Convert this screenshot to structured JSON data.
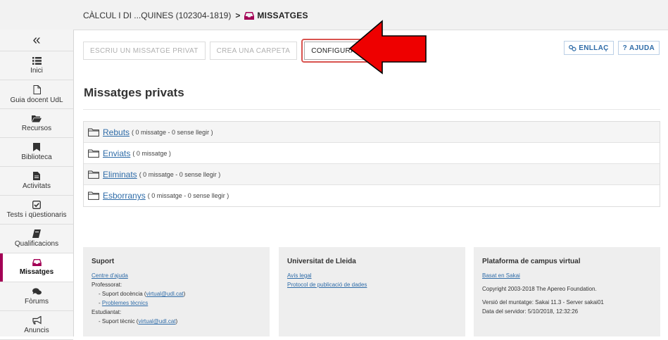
{
  "breadcrumb": {
    "site": "CÀLCUL I DI ...QUINES (102304-1819)",
    "separator": ">",
    "current": "MISSATGES"
  },
  "sidebar": {
    "collapse_glyph": "«",
    "items": [
      {
        "label": "Inici",
        "icon": "list-icon"
      },
      {
        "label": "Guia docent UdL",
        "icon": "document-icon"
      },
      {
        "label": "Recursos",
        "icon": "folder-open-icon"
      },
      {
        "label": "Biblioteca",
        "icon": "bookmark-icon"
      },
      {
        "label": "Activitats",
        "icon": "file-text-icon"
      },
      {
        "label": "Tests i qüestionaris",
        "icon": "check-square-icon"
      },
      {
        "label": "Qualificacions",
        "icon": "book-icon"
      },
      {
        "label": "Missatges",
        "icon": "inbox-icon",
        "active": true
      },
      {
        "label": "Fòrums",
        "icon": "comments-icon"
      },
      {
        "label": "Anuncis",
        "icon": "bullhorn-icon"
      }
    ]
  },
  "toolbar": {
    "private_message": "ESCRIU UN MISSATGE PRIVAT",
    "create_folder": "CREA UNA CARPETA",
    "settings": "CONFIGURACIÓ"
  },
  "right_buttons": {
    "link": "ENLLAÇ",
    "help": "AJUDA"
  },
  "page_title": "Missatges privats",
  "folders": [
    {
      "name": "Rebuts",
      "count": "( 0 missatge - 0 sense llegir )"
    },
    {
      "name": "Enviats",
      "count": "( 0 missatge )"
    },
    {
      "name": "Eliminats",
      "count": "( 0 missatge - 0 sense llegir )"
    },
    {
      "name": "Esborranys",
      "count": "( 0 missatge - 0 sense llegir )"
    }
  ],
  "footer": {
    "support": {
      "title": "Suport",
      "help_center": "Centre d'ajuda",
      "teachers": "Professorat:",
      "teaching_support_prefix": "- Suport docència (",
      "teaching_support_email": "virtual@udl.cat",
      "teaching_support_suffix": ")",
      "technical_problems_prefix": "- ",
      "technical_problems": "Problemes tècnics",
      "students": "Estudiantat:",
      "tech_support_prefix": "- Suport tècnic (",
      "tech_support_email": "virtual@udl.cat",
      "tech_support_suffix": ")"
    },
    "university": {
      "title": "Universitat de Lleida",
      "legal": "Avís legal",
      "protocol": "Protocol de publicació de dades"
    },
    "platform": {
      "title": "Plataforma de campus virtual",
      "based_on": "Basat en Sakai",
      "copyright": "Copyright 2003-2018 The Apereo Foundation.",
      "version": "Versió del muntatge: Sakai 11.3 - Server sakai01",
      "server_date": "Data del servidor: 5/10/2018, 12:32:26"
    }
  },
  "colors": {
    "accent": "#a30055",
    "link": "#2f6ca8",
    "highlight_ring": "#d9534f",
    "arrow": "#ee0000"
  }
}
